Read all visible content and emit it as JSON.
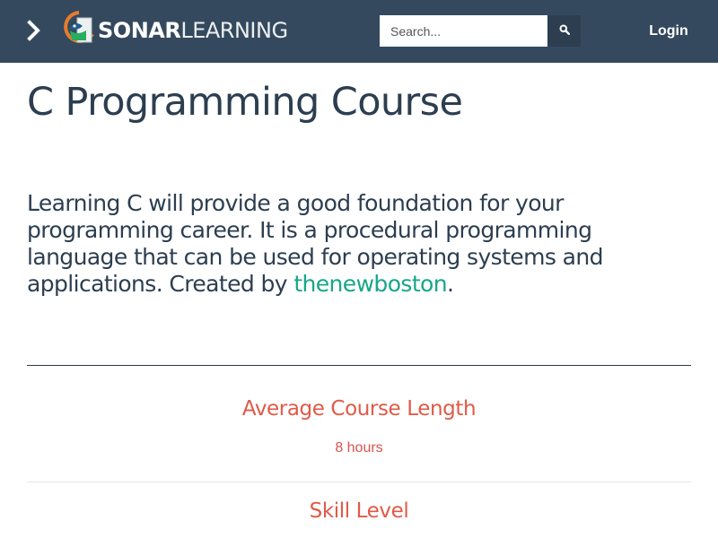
{
  "navbar": {
    "brand_bold": "SONAR",
    "brand_light": "LEARNING",
    "search_placeholder": "Search...",
    "login_label": "Login",
    "icons": {
      "toggle": "chevron-right-icon",
      "search": "search-icon",
      "logo": "sonar-logo-icon"
    }
  },
  "course": {
    "title": "C Programming Course",
    "description_prefix": "Learning C will provide a good foundation for your programming career. It is a procedural programming language that can be used for operating systems and applications. Created by ",
    "author": "thenewboston",
    "description_suffix": "."
  },
  "stats": {
    "length_label": "Average Course Length",
    "length_value": "8 hours",
    "skill_label": "Skill Level"
  },
  "colors": {
    "navbar_bg": "#34495e",
    "title_text": "#2c3e50",
    "accent_link": "#18a689",
    "stat_accent": "#e05a47"
  }
}
